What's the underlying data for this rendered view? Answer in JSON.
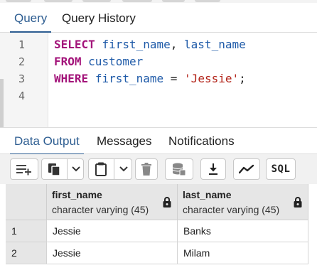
{
  "query_tabs": [
    {
      "label": "Query",
      "active": true
    },
    {
      "label": "Query History",
      "active": false
    }
  ],
  "editor": {
    "line_numbers": [
      "1",
      "2",
      "3",
      "4"
    ],
    "lines": [
      [
        {
          "t": "kw",
          "v": "SELECT"
        },
        {
          "t": "pl",
          "v": " "
        },
        {
          "t": "id",
          "v": "first_name"
        },
        {
          "t": "pl",
          "v": ", "
        },
        {
          "t": "id",
          "v": "last_name"
        }
      ],
      [
        {
          "t": "kw",
          "v": "FROM"
        },
        {
          "t": "pl",
          "v": " "
        },
        {
          "t": "id",
          "v": "customer"
        }
      ],
      [
        {
          "t": "kw",
          "v": "WHERE"
        },
        {
          "t": "pl",
          "v": " "
        },
        {
          "t": "id",
          "v": "first_name"
        },
        {
          "t": "pl",
          "v": " = "
        },
        {
          "t": "str",
          "v": "'Jessie'"
        },
        {
          "t": "pl",
          "v": ";"
        }
      ],
      []
    ]
  },
  "output_tabs": [
    {
      "label": "Data Output",
      "active": true
    },
    {
      "label": "Messages",
      "active": false
    },
    {
      "label": "Notifications",
      "active": false
    }
  ],
  "toolbar": {
    "buttons": [
      "add-row-icon",
      "copy-icon",
      "chevron-down-icon",
      "paste-icon",
      "chevron-down-icon",
      "delete-icon",
      "save-data-icon",
      "download-icon",
      "graph-icon",
      "sql-icon"
    ],
    "sql_label": "SQL"
  },
  "grid": {
    "columns": [
      {
        "name": "first_name",
        "type": "character varying (45)"
      },
      {
        "name": "last_name",
        "type": "character varying (45)"
      }
    ],
    "rows": [
      {
        "num": "1",
        "cells": [
          "Jessie",
          "Banks"
        ]
      },
      {
        "num": "2",
        "cells": [
          "Jessie",
          "Milam"
        ]
      }
    ]
  },
  "colors": {
    "accent": "#2d5d91",
    "keyword": "#a3147a",
    "identifier": "#1e5aa8",
    "string": "#b3241a"
  }
}
